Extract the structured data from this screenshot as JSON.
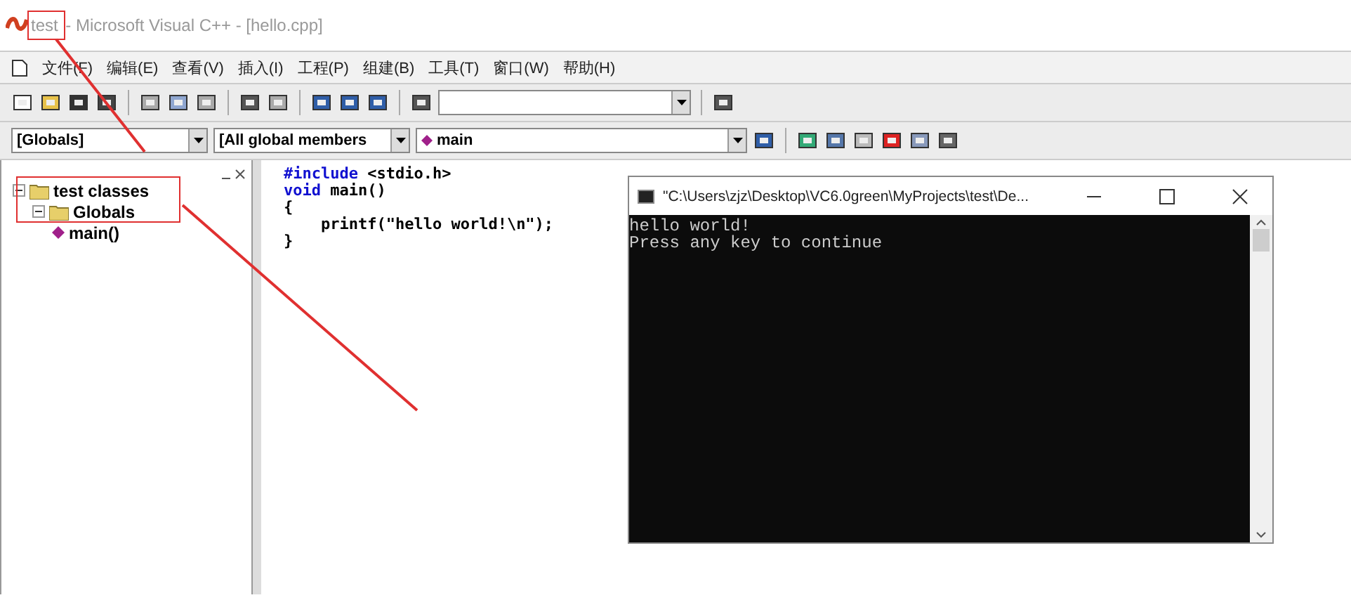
{
  "window": {
    "project": "test",
    "title": " - Microsoft Visual C++ - [hello.cpp]"
  },
  "menu": [
    {
      "label": "文件(F)"
    },
    {
      "label": "编辑(E)"
    },
    {
      "label": "查看(V)"
    },
    {
      "label": "插入(I)"
    },
    {
      "label": "工程(P)"
    },
    {
      "label": "组建(B)"
    },
    {
      "label": "工具(T)"
    },
    {
      "label": "窗口(W)"
    },
    {
      "label": "帮助(H)"
    }
  ],
  "wizard_bar": {
    "class_combo": "[Globals]",
    "filter_combo": "[All global members",
    "member_combo": "main"
  },
  "tree": [
    {
      "label": "test classes",
      "expanded": true,
      "children": [
        {
          "label": "Globals",
          "expanded": true,
          "children": [
            {
              "label": "main()"
            }
          ]
        }
      ]
    }
  ],
  "editor": {
    "lines": [
      [
        {
          "text": "#include",
          "kind": "keyword"
        },
        {
          "text": " <stdio.h>",
          "kind": "plain"
        }
      ],
      [
        {
          "text": "void",
          "kind": "keyword"
        },
        {
          "text": " main()",
          "kind": "plain"
        }
      ],
      [
        {
          "text": "{",
          "kind": "plain"
        }
      ],
      [
        {
          "text": "    printf(\"hello world!\\n\");",
          "kind": "plain"
        }
      ],
      [
        {
          "text": "}",
          "kind": "plain"
        }
      ]
    ]
  },
  "console": {
    "title": "\"C:\\Users\\zjz\\Desktop\\VC6.0green\\MyProjects\\test\\De...",
    "lines": [
      "hello world!",
      "Press any key to continue"
    ]
  }
}
